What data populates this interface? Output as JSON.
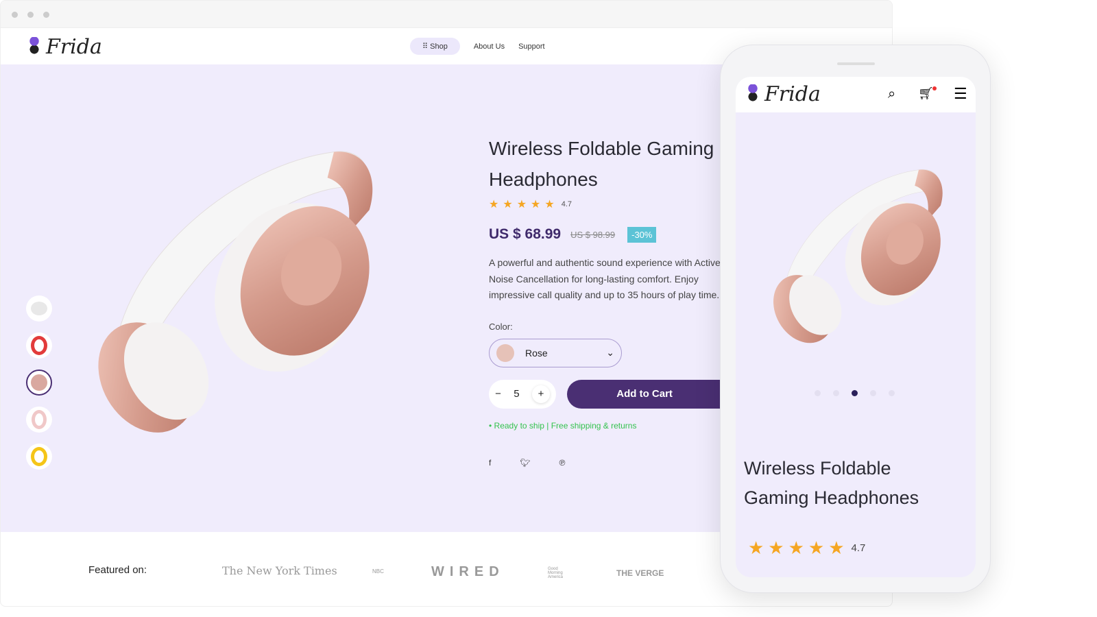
{
  "brand": {
    "name": "Frida"
  },
  "nav": {
    "items": [
      {
        "label": "Shop"
      },
      {
        "label": "About Us"
      },
      {
        "label": "Support"
      }
    ]
  },
  "product": {
    "title": "Wireless Foldable Gaming Headphones",
    "rating": 4.7,
    "rating_label": "4.7",
    "price": "US $ 68.99",
    "old_price": "US $ 98.99",
    "discount": "-30%",
    "description": "A powerful and authentic sound experience with Active Noise Cancellation for long-lasting comfort. Enjoy impressive call quality and up to 35 hours of play time.",
    "color_label": "Color:",
    "color_value": "Rose",
    "quantity": "5",
    "add_to_cart": "Add to Cart",
    "shipping": "Ready to ship | Free shipping & returns",
    "thumbnails": [
      {
        "color": "#e8e8e8"
      },
      {
        "color": "#e23b3b"
      },
      {
        "color": "#d9a8a0"
      },
      {
        "color": "#f0c8c8"
      },
      {
        "color": "#f5c518"
      }
    ],
    "selected_thumbnail": 3
  },
  "social": [
    "facebook-icon",
    "twitter-icon",
    "pinterest-icon"
  ],
  "featured": {
    "label": "Featured on:",
    "logos": [
      "The New York Times",
      "NBC",
      "WIRED",
      "Good Morning America",
      "THE VERGE"
    ]
  },
  "mobile": {
    "title": "Wireless Foldable Gaming Headphones",
    "rating_label": "4.7",
    "carousel_active": 3,
    "carousel_count": 5
  },
  "colors": {
    "accent": "#4a2f73",
    "hero_bg": "#f0ecfc",
    "star": "#f5a623",
    "badge": "#5cc3d6",
    "ship": "#33c24d"
  }
}
